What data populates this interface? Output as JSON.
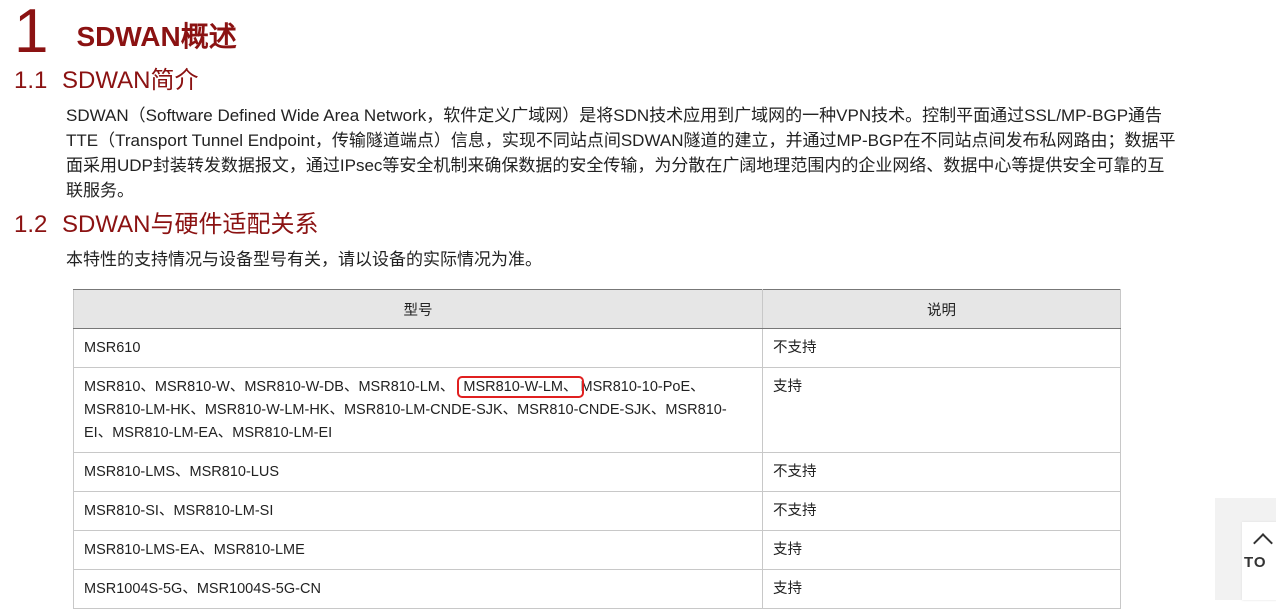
{
  "chapter": {
    "number": "1",
    "title": "SDWAN概述"
  },
  "sections": [
    {
      "number": "1.1",
      "title": "SDWAN简介",
      "paragraph": "SDWAN（Software Defined Wide Area Network，软件定义广域网）是将SDN技术应用到广域网的一种VPN技术。控制平面通过SSL/MP-BGP通告TTE（Transport Tunnel Endpoint，传输隧道端点）信息，实现不同站点间SDWAN隧道的建立，并通过MP-BGP在不同站点间发布私网路由；数据平面采用UDP封装转发数据报文，通过IPsec等安全机制来确保数据的安全传输，为分散在广阔地理范围内的企业网络、数据中心等提供安全可靠的互联服务。"
    },
    {
      "number": "1.2",
      "title": "SDWAN与硬件适配关系",
      "paragraph": "本特性的支持情况与设备型号有关，请以设备的实际情况为准。"
    }
  ],
  "table": {
    "headers": [
      "型号",
      "说明"
    ],
    "rows": [
      {
        "model": "MSR610",
        "note": "不支持"
      },
      {
        "model_before": "MSR810、MSR810-W、MSR810-W-DB、MSR810-LM、",
        "model_highlight": "MSR810-W-LM、",
        "model_after": "MSR810-10-PoE、MSR810-LM-HK、MSR810-W-LM-HK、MSR810-LM-CNDE-SJK、MSR810-CNDE-SJK、MSR810-EI、MSR810-LM-EA、MSR810-LM-EI",
        "note": "支持"
      },
      {
        "model": "MSR810-LMS、MSR810-LUS",
        "note": "不支持"
      },
      {
        "model": "MSR810-SI、MSR810-LM-SI",
        "note": "不支持"
      },
      {
        "model": "MSR810-LMS-EA、MSR810-LME",
        "note": "支持"
      },
      {
        "model": "MSR1004S-5G、MSR1004S-5G-CN",
        "note": "支持"
      }
    ]
  },
  "back_to_top": {
    "label": "TO",
    "icon": "chevron-up-icon"
  },
  "colors": {
    "heading": "#8b1212",
    "highlight_box": "#e02020",
    "table_header_bg": "#e6e6e6"
  }
}
